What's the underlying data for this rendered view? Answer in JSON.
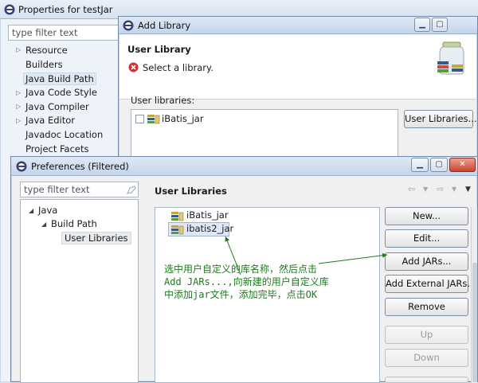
{
  "properties_window": {
    "title": "Properties for testJar",
    "filter_placeholder": "type filter text",
    "tree": [
      {
        "label": "Resource",
        "expandable": true
      },
      {
        "label": "Builders",
        "expandable": false
      },
      {
        "label": "Java Build Path",
        "expandable": false,
        "selected": true
      },
      {
        "label": "Java Code Style",
        "expandable": true
      },
      {
        "label": "Java Compiler",
        "expandable": true
      },
      {
        "label": "Java Editor",
        "expandable": true
      },
      {
        "label": "Javadoc Location",
        "expandable": false
      },
      {
        "label": "Project Facets",
        "expandable": false
      }
    ]
  },
  "add_library_window": {
    "title": "Add Library",
    "header_title": "User Library",
    "error_message": "Select a library.",
    "user_libraries_label": "User libraries:",
    "libraries": [
      {
        "label": "iBatis_jar",
        "checked": false
      }
    ],
    "user_libraries_button": "User Libraries..."
  },
  "preferences_window": {
    "title": "Preferences (Filtered)",
    "filter_placeholder": "type filter text",
    "tree": {
      "java": "Java",
      "build_path": "Build Path",
      "user_libraries": "User Libraries"
    },
    "page_title": "User Libraries",
    "libraries": [
      {
        "label": "iBatis_jar",
        "selected": false
      },
      {
        "label": "ibatis2_jar",
        "selected": true
      }
    ],
    "buttons": {
      "new": "New...",
      "edit": "Edit...",
      "add_jars": "Add JARs...",
      "add_external_jars": "Add External JARs...",
      "remove": "Remove",
      "up": "Up",
      "down": "Down"
    }
  },
  "annotation": {
    "line1": "选中用户自定义的库名称，然后点击",
    "line2": "Add JARs...,向新建的用户自定义库",
    "line3": "中添加jar文件，添加完毕，点击OK"
  },
  "colors": {
    "annotation_green": "#1f7a1f",
    "selection": "#dfe8f6",
    "error_red": "#d22f2f"
  }
}
